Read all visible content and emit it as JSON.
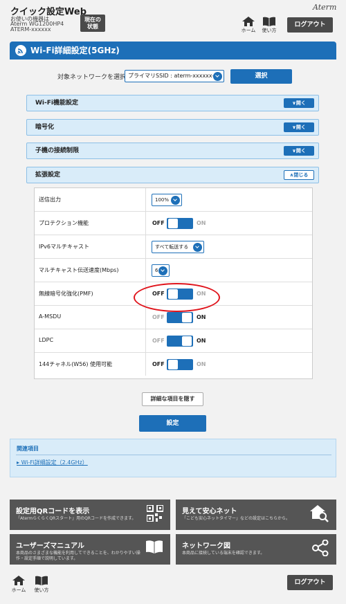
{
  "header": {
    "app_title": "クイック設定Web",
    "device_label": "お使いの機器は",
    "device_model": "Aterm WG1200HP4",
    "device_name": "ATERM-xxxxxx",
    "status_button": "現在の\n状態",
    "brand": "Aterm",
    "home": "ホーム",
    "help": "使い方",
    "logout": "ログアウト"
  },
  "page": {
    "title": "Wi-Fi詳細設定(5GHz)",
    "network_label": "対象ネットワークを選択",
    "network_value": "プライマリSSID : aterm-xxxxxx-x",
    "select_button": "選択"
  },
  "accordions": [
    {
      "label": "Wi-Fi機能設定",
      "button": "∨開く"
    },
    {
      "label": "暗号化",
      "button": "∨開く"
    },
    {
      "label": "子機の接続制限",
      "button": "∨開く"
    },
    {
      "label": "拡張設定",
      "button": "∧閉じる"
    }
  ],
  "settings": {
    "tx_power": {
      "label": "送信出力",
      "value": "100%"
    },
    "protection": {
      "label": "プロテクション機能",
      "off": "OFF",
      "on": "ON",
      "state": "off"
    },
    "ipv6": {
      "label": "IPv6マルチキャスト",
      "value": "すべて転送する"
    },
    "mcast_rate": {
      "label": "マルチキャスト伝送速度(Mbps)",
      "value": "6"
    },
    "pmf": {
      "label": "無線暗号化強化(PMF)",
      "off": "OFF",
      "on": "ON",
      "state": "off"
    },
    "amsdu": {
      "label": "A-MSDU",
      "off": "OFF",
      "on": "ON",
      "state": "on"
    },
    "ldpc": {
      "label": "LDPC",
      "off": "OFF",
      "on": "ON",
      "state": "on"
    },
    "ch144": {
      "label": "144チャネル(W56) 使用可能",
      "off": "OFF",
      "on": "ON",
      "state": "off"
    }
  },
  "actions": {
    "hide_details": "詳細な項目を隠す",
    "save": "設定"
  },
  "related": {
    "heading": "関連項目",
    "link": "Wi-Fi詳細設定（2.4GHz）"
  },
  "tiles": [
    {
      "title": "設定用QRコードを表示",
      "sub": "「AtermらくらくQRスタート」用のQRコードを作成できます。"
    },
    {
      "title": "見えて安心ネット",
      "sub": "「こども安心ネットタイマー」などの設定はこちらから。"
    },
    {
      "title": "ユーザーズマニュアル",
      "sub": "本商品のさまざまな機能を利用してできることを、わかりやすい操作・設定手順で説明しています。"
    },
    {
      "title": "ネットワーク図",
      "sub": "本商品に接続している端末を確認できます。"
    }
  ],
  "colors": {
    "primary": "#1d6fb8",
    "accent_ring": "#e0141c",
    "tile_bg": "#555555"
  }
}
